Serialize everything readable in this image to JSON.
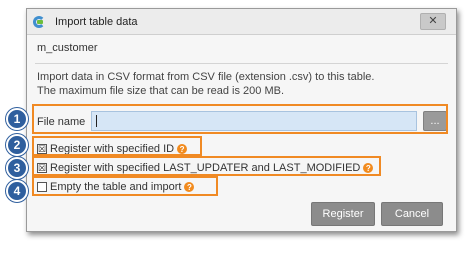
{
  "dialog": {
    "title": "Import table data",
    "close_label": "✕",
    "table_name": "m_customer",
    "description_line1": "Import data in CSV format from CSV file (extension .csv) to this table.",
    "description_line2": "The maximum file size that can be read is 200 MB."
  },
  "file_row": {
    "label": "File name",
    "value": "",
    "browse_label": "..."
  },
  "options": [
    {
      "label": "Register with specified ID",
      "checked": true,
      "check_mark": "☒",
      "help_mark": "?"
    },
    {
      "label": "Register with specified LAST_UPDATER and LAST_MODIFIED",
      "checked": true,
      "check_mark": "☒",
      "help_mark": "?"
    },
    {
      "label": "Empty the table and import",
      "checked": false,
      "check_mark": "",
      "help_mark": "?"
    }
  ],
  "buttons": {
    "register": "Register",
    "cancel": "Cancel"
  },
  "callouts": [
    "1",
    "2",
    "3",
    "4"
  ],
  "colors": {
    "highlight": "#f08a24",
    "badge": "#2f5f9e",
    "help_icon": "#f28b1e",
    "file_input_bg": "#d6e6f6"
  }
}
